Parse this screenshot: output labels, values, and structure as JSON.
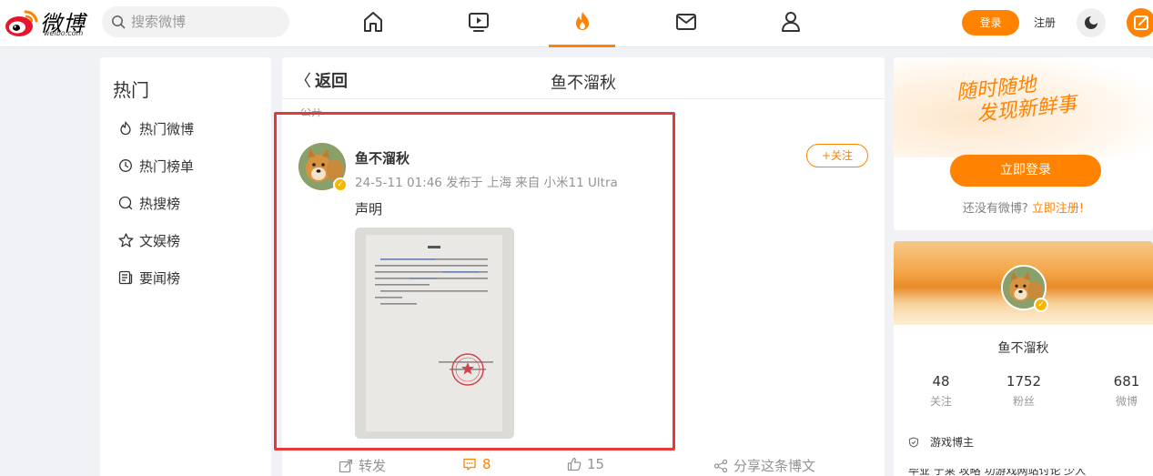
{
  "header": {
    "logo_text": "微博",
    "logo_sub": "weibo.com",
    "search_placeholder": "搜索微博",
    "nav_icons": [
      "home-icon",
      "video-icon",
      "hot-icon",
      "mail-icon",
      "user-icon"
    ],
    "active_nav": "hot",
    "login_label": "登录",
    "register_label": "注册"
  },
  "sidebar": {
    "title": "热门",
    "items": [
      {
        "label": "热门微博",
        "icon": "flame-icon"
      },
      {
        "label": "热门榜单",
        "icon": "clock-icon"
      },
      {
        "label": "热搜榜",
        "icon": "search-icon"
      },
      {
        "label": "文娱榜",
        "icon": "star-icon"
      },
      {
        "label": "要闻榜",
        "icon": "news-icon"
      }
    ]
  },
  "main": {
    "back_label": "返回",
    "title": "鱼不溜秋",
    "visibility": "公开",
    "post": {
      "author": "鱼不溜秋",
      "meta": "24-5-11 01:46 发布于 上海 来自 小米11 Ultra",
      "follow_label": "+关注",
      "text": "声明",
      "image_alt": "声明"
    },
    "actions": {
      "repost": "转发",
      "comments": "8",
      "likes": "15",
      "share": "分享这条博文"
    }
  },
  "right": {
    "slogan_line1": "随时随地",
    "slogan_line2": "发现新鲜事",
    "login_button": "立即登录",
    "note_prefix": "还没有微博?",
    "note_link": "立即注册!",
    "profile": {
      "name": "鱼不溜秋",
      "stats": [
        {
          "num": "48",
          "label": "关注"
        },
        {
          "num": "1752",
          "label": "粉丝"
        },
        {
          "num": "681",
          "label": "微博"
        }
      ],
      "tag": "游戏博主",
      "line2": "毕业 宁莱 攻略 功游戏网站讨论 少人"
    }
  },
  "colors": {
    "accent": "#ff8200",
    "highlight_box": "#e53838"
  }
}
